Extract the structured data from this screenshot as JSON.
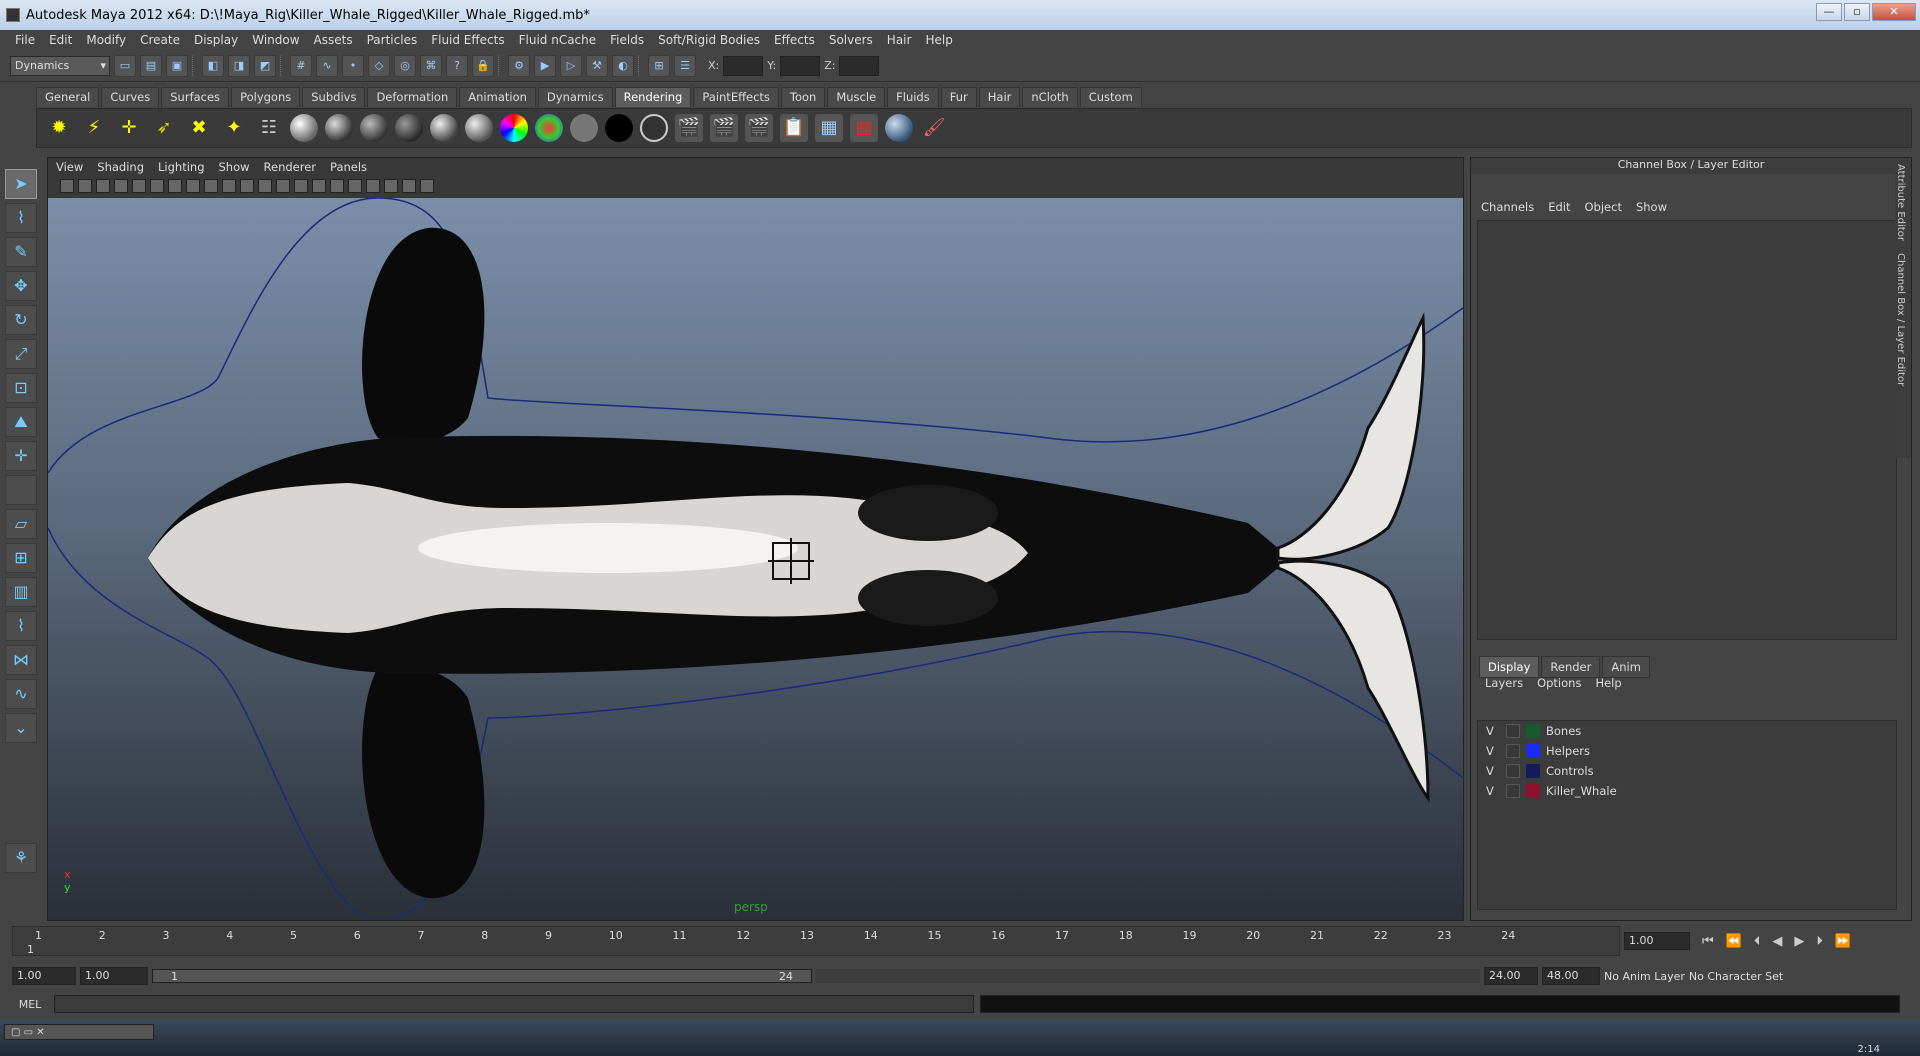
{
  "window": {
    "title": "Autodesk Maya 2012 x64: D:\\!Maya_Rig\\Killer_Whale_Rigged\\Killer_Whale_Rigged.mb*"
  },
  "menubar": [
    "File",
    "Edit",
    "Modify",
    "Create",
    "Display",
    "Window",
    "Assets",
    "Particles",
    "Fluid Effects",
    "Fluid nCache",
    "Fields",
    "Soft/Rigid Bodies",
    "Effects",
    "Solvers",
    "Hair",
    "Help"
  ],
  "statusline": {
    "mode": "Dynamics",
    "x_label": "X:",
    "y_label": "Y:",
    "z_label": "Z:"
  },
  "shelf_tabs": [
    "General",
    "Curves",
    "Surfaces",
    "Polygons",
    "Subdivs",
    "Deformation",
    "Animation",
    "Dynamics",
    "Rendering",
    "PaintEffects",
    "Toon",
    "Muscle",
    "Fluids",
    "Fur",
    "Hair",
    "nCloth",
    "Custom"
  ],
  "shelf_active": "Rendering",
  "viewport": {
    "menu": [
      "View",
      "Shading",
      "Lighting",
      "Show",
      "Renderer",
      "Panels"
    ],
    "camera": "persp",
    "axis_x": "x",
    "axis_y": "y"
  },
  "channel_box": {
    "title": "Channel Box / Layer Editor",
    "menu": [
      "Channels",
      "Edit",
      "Object",
      "Show"
    ],
    "side_tabs": [
      "Attribute Editor",
      "Channel Box / Layer Editor"
    ]
  },
  "layer_editor": {
    "tabs": [
      "Display",
      "Render",
      "Anim"
    ],
    "active_tab": "Display",
    "menu": [
      "Layers",
      "Options",
      "Help"
    ],
    "layers": [
      {
        "visible": "V",
        "name": "Bones",
        "color": "#1a5a2a"
      },
      {
        "visible": "V",
        "name": "Helpers",
        "color": "#1a2aee"
      },
      {
        "visible": "V",
        "name": "Controls",
        "color": "#141a5a"
      },
      {
        "visible": "V",
        "name": "Killer_Whale",
        "color": "#8a1430"
      }
    ]
  },
  "timeline": {
    "ticks": [
      "1",
      "2",
      "3",
      "4",
      "5",
      "6",
      "7",
      "8",
      "9",
      "10",
      "11",
      "12",
      "13",
      "14",
      "15",
      "16",
      "17",
      "18",
      "19",
      "20",
      "21",
      "22",
      "23",
      "24"
    ],
    "current_frame_marker": "1",
    "current_frame": "1.00"
  },
  "range": {
    "start_time": "1.00",
    "playback_start": "1.00",
    "range_start_label": "1",
    "range_end_label": "24",
    "playback_end": "24.00",
    "end_time": "48.00",
    "anim_layer": "No Anim Layer",
    "character_set": "No Character Set"
  },
  "command_line": {
    "label": "MEL"
  },
  "taskbar": {
    "clock": "2:14"
  }
}
